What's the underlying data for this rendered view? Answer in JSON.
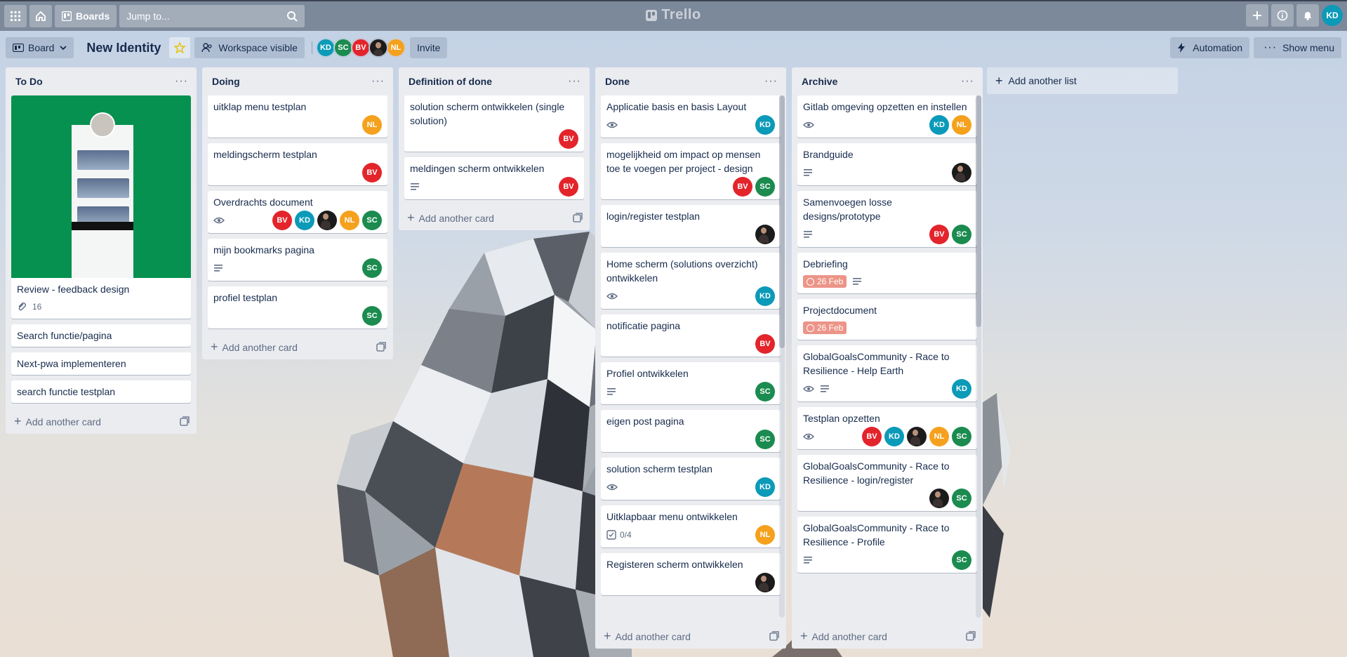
{
  "topbar": {
    "boards_label": "Boards",
    "jump_placeholder": "Jump to...",
    "logo_text": "Trello",
    "user_initials": "KD"
  },
  "board": {
    "view_label": "Board",
    "title": "New Identity",
    "visibility_label": "Workspace visible",
    "members": [
      "KD",
      "SC",
      "BV",
      "PH",
      "NL"
    ],
    "invite_label": "Invite",
    "automation_label": "Automation",
    "show_menu_label": "Show menu"
  },
  "add_card_label": "Add another card",
  "add_list_label": "Add another list",
  "lists": [
    {
      "title": "To Do",
      "cards": [
        {
          "title": "Review - feedback design",
          "cover": true,
          "attachments": "16",
          "members": []
        },
        {
          "title": "Search functie/pagina",
          "members": []
        },
        {
          "title": "Next-pwa implementeren",
          "members": []
        },
        {
          "title": "search functie testplan",
          "members": []
        }
      ]
    },
    {
      "title": "Doing",
      "cards": [
        {
          "title": "uitklap menu testplan",
          "members": [
            "NL"
          ]
        },
        {
          "title": "meldingscherm testplan",
          "members": [
            "BV"
          ]
        },
        {
          "title": "Overdrachts document",
          "watch": true,
          "members": [
            "BV",
            "KD",
            "PH",
            "NL",
            "SC"
          ]
        },
        {
          "title": "mijn bookmarks pagina",
          "desc": true,
          "members": [
            "SC"
          ]
        },
        {
          "title": "profiel testplan",
          "members": [
            "SC"
          ]
        }
      ]
    },
    {
      "title": "Definition of done",
      "cards": [
        {
          "title": "solution scherm ontwikkelen (single solution)",
          "members": [
            "BV"
          ]
        },
        {
          "title": "meldingen scherm ontwikkelen",
          "desc": true,
          "members": [
            "BV"
          ]
        }
      ]
    },
    {
      "title": "Done",
      "cards": [
        {
          "title": "Applicatie basis en basis Layout",
          "watch": true,
          "members": [
            "KD"
          ]
        },
        {
          "title": "mogelijkheid om impact op mensen toe te voegen per project - design",
          "members": [
            "BV",
            "SC"
          ]
        },
        {
          "title": "login/register testplan",
          "members": [
            "PH"
          ]
        },
        {
          "title": "Home scherm (solutions overzicht) ontwikkelen",
          "watch": true,
          "members": [
            "KD"
          ]
        },
        {
          "title": "notificatie pagina",
          "members": [
            "BV"
          ]
        },
        {
          "title": "Profiel ontwikkelen",
          "desc": true,
          "members": [
            "SC"
          ]
        },
        {
          "title": "eigen post pagina",
          "members": [
            "SC"
          ]
        },
        {
          "title": "solution scherm testplan",
          "watch": true,
          "members": [
            "KD"
          ]
        },
        {
          "title": "Uitklapbaar menu ontwikkelen",
          "checklist": "0/4",
          "members": [
            "NL"
          ]
        },
        {
          "title": "Registeren scherm ontwikkelen",
          "members": [
            "PH"
          ]
        }
      ]
    },
    {
      "title": "Archive",
      "cards": [
        {
          "title": "Gitlab omgeving opzetten en instellen",
          "watch": true,
          "members": [
            "KD",
            "NL"
          ]
        },
        {
          "title": "Brandguide",
          "desc": true,
          "members": [
            "PH"
          ]
        },
        {
          "title": "Samenvoegen losse designs/prototype",
          "desc": true,
          "members": [
            "BV",
            "SC"
          ]
        },
        {
          "title": "Debriefing",
          "due": "26 Feb",
          "desc": true,
          "members": []
        },
        {
          "title": "Projectdocument",
          "due": "26 Feb",
          "members": []
        },
        {
          "title": "GlobalGoalsCommunity - Race to Resilience - Help Earth",
          "watch": true,
          "desc": true,
          "members": [
            "KD"
          ]
        },
        {
          "title": "Testplan opzetten",
          "watch": true,
          "members": [
            "BV",
            "KD",
            "PH",
            "NL",
            "SC"
          ]
        },
        {
          "title": "GlobalGoalsCommunity - Race to Resilience - login/register",
          "members": [
            "PH",
            "SC"
          ]
        },
        {
          "title": "GlobalGoalsCommunity - Race to Resilience - Profile",
          "desc": true,
          "members": [
            "SC"
          ]
        }
      ]
    }
  ],
  "colors": {
    "KD": "#0b9ab8",
    "SC": "#1b8b4f",
    "BV": "#e3242b",
    "NL": "#f5a11d",
    "PH": "#1b1b1b"
  },
  "icons": [
    "apps-grid-icon",
    "home-icon",
    "boards-icon",
    "search-icon",
    "plus-icon",
    "info-icon",
    "bell-icon",
    "star-icon",
    "eye-icon",
    "description-icon",
    "attachment-icon",
    "checklist-icon",
    "clock-icon",
    "template-icon",
    "lightning-icon",
    "ellipsis-icon"
  ]
}
